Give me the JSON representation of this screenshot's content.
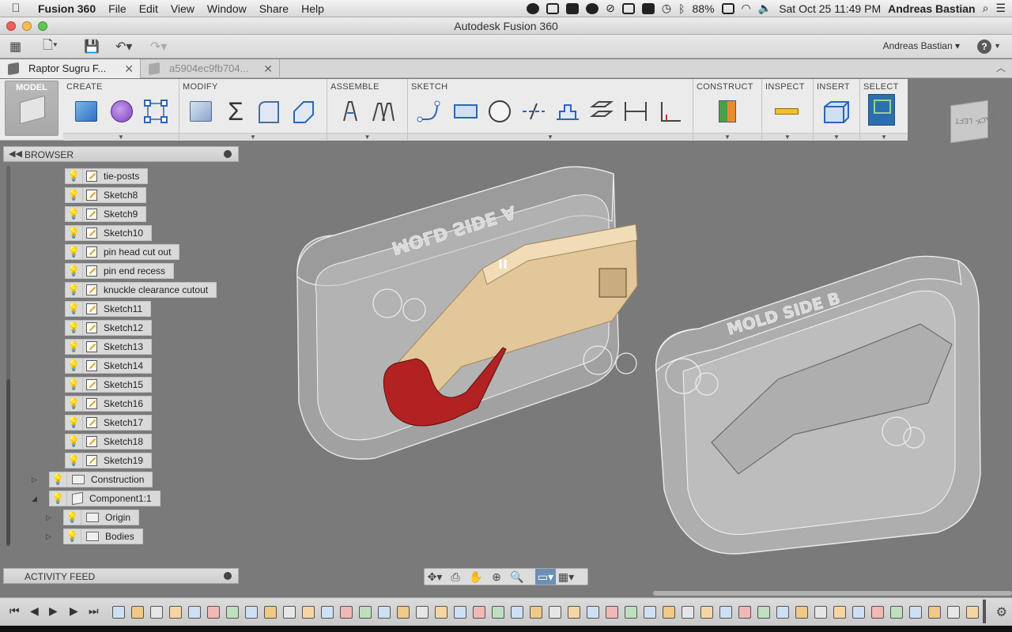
{
  "menubar": {
    "app": "Fusion 360",
    "items": [
      "File",
      "Edit",
      "View",
      "Window",
      "Share",
      "Help"
    ],
    "battery": "88%",
    "datetime": "Sat Oct 25  11:49 PM",
    "user": "Andreas Bastian"
  },
  "window": {
    "title": "Autodesk Fusion 360"
  },
  "qat": {
    "user": "Andreas Bastian ▾",
    "help": "?"
  },
  "tabs": [
    {
      "label": "Raptor Sugru F...",
      "active": true
    },
    {
      "label": "a5904ec9fb704...",
      "active": false
    }
  ],
  "ribbon": {
    "workspace": "MODEL",
    "panels": [
      "CREATE",
      "MODIFY",
      "ASSEMBLE",
      "SKETCH",
      "CONSTRUCT",
      "INSPECT",
      "INSERT",
      "SELECT"
    ]
  },
  "viewcube": {
    "left": "LEFT",
    "back": "BACK"
  },
  "browser": {
    "title": "BROWSER",
    "sketches": [
      "tie-posts",
      "Sketch8",
      "Sketch9",
      "Sketch10",
      "pin head cut out",
      "pin end recess",
      "knuckle clearance cutout",
      "Sketch11",
      "Sketch12",
      "Sketch13",
      "Sketch14",
      "Sketch15",
      "Sketch16",
      "Sketch17",
      "Sketch18",
      "Sketch19"
    ],
    "construction": "Construction",
    "component": "Component1:1",
    "origin": "Origin",
    "bodies": "Bodies"
  },
  "activity": {
    "title": "ACTIVITY FEED"
  },
  "model": {
    "mold_a_text": "MOLD SIDE A",
    "mold_b_text": "MOLD SIDE B",
    "part_text": "II"
  },
  "colors": {
    "tan": "#e2c79a",
    "red": "#b22222",
    "mold": "#b7b7b7",
    "background": "#7a7a7a",
    "accent": "#2b6fae"
  }
}
